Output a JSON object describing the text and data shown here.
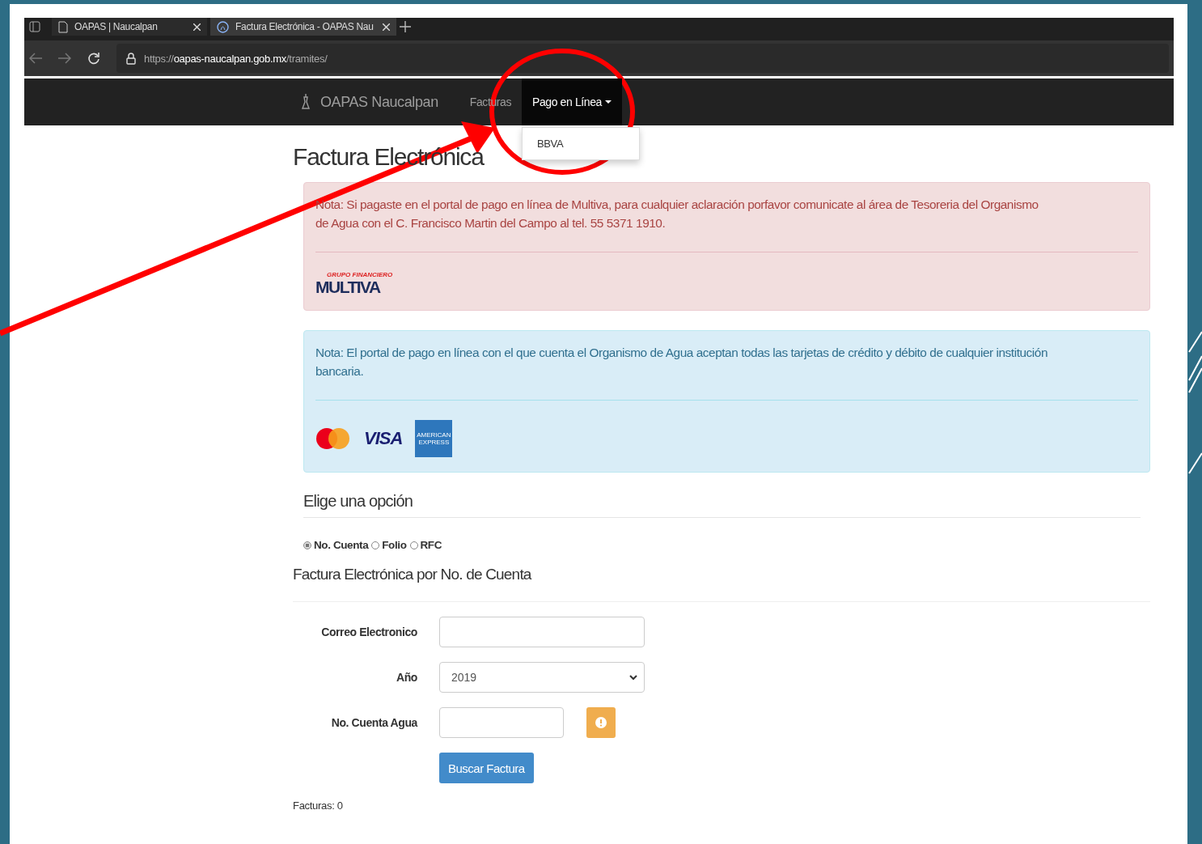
{
  "browser": {
    "tabs": [
      {
        "title": "OAPAS | Naucalpan",
        "selected": false
      },
      {
        "title": "Factura Electrónica - OAPAS Nau",
        "selected": true
      }
    ],
    "url": {
      "scheme": "https://",
      "host": "oapas-naucalpan.gob.mx",
      "path": "/tramites/"
    }
  },
  "navbar": {
    "brand": "OAPAS Naucalpan",
    "items": [
      {
        "label": "Facturas",
        "selected": false,
        "dropdown": false
      },
      {
        "label": "Pago en Línea",
        "selected": true,
        "dropdown": true
      }
    ],
    "menu": [
      "BBVA"
    ]
  },
  "page": {
    "title": "Factura Electrónica",
    "alerts": [
      {
        "kind": "danger",
        "text": "Nota: Si pagaste en el portal de pago en línea de Multiva, para cualquier aclaración porfavor comunicate al área de Tesoreria del Organismo de Agua con el C. Francisco Martin del Campo al tel. 55 5371 1910.",
        "logos": [
          {
            "kind": "multiva",
            "top": "GRUPO FINANCIERO",
            "name": "MULTIVA"
          }
        ]
      },
      {
        "kind": "info",
        "text": "Nota: El portal de pago en línea con el que cuenta el Organismo de Agua aceptan todas las tarjetas de crédito y débito de cualquier institución bancaria.",
        "logos": [
          {
            "kind": "mastercard"
          },
          {
            "kind": "visa",
            "name": "VISA"
          },
          {
            "kind": "amex",
            "name": "AMERICAN EXPRESS"
          }
        ]
      }
    ],
    "options_title": "Elige una opción",
    "options": [
      {
        "label": "No. Cuenta",
        "selected": true
      },
      {
        "label": "Folio",
        "selected": false
      },
      {
        "label": "RFC",
        "selected": false
      }
    ],
    "form_title": "Factura Electrónica por No. de Cuenta",
    "fields": [
      {
        "kind": "text",
        "label": "Correo Electronico"
      },
      {
        "kind": "select",
        "label": "Año",
        "value": "2019"
      },
      {
        "kind": "short",
        "label": "No. Cuenta Agua"
      }
    ],
    "submit": "Buscar Factura",
    "count": "Facturas: 0"
  }
}
